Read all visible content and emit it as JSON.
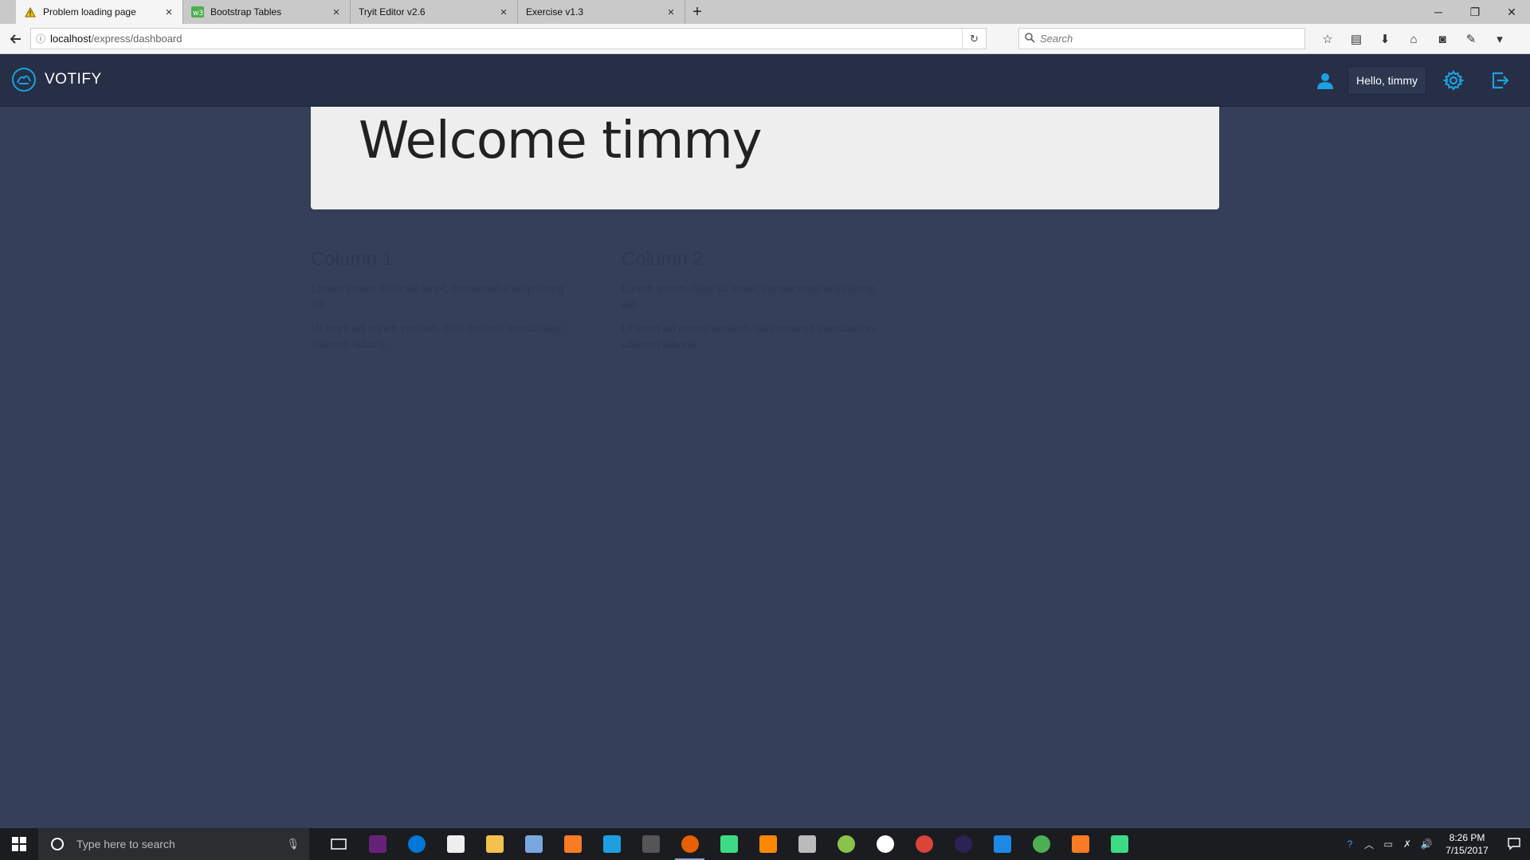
{
  "browser": {
    "tabs": [
      {
        "label": "Problem loading page",
        "icon": "warning-icon"
      },
      {
        "label": "Bootstrap Tables",
        "icon": "w3-icon"
      },
      {
        "label": "Tryit Editor v2.6",
        "icon": "none"
      },
      {
        "label": "Exercise v1.3",
        "icon": "none"
      }
    ],
    "url_host": "localhost",
    "url_path": "/express/dashboard",
    "search_placeholder": "Search"
  },
  "app": {
    "brand": "VOTIFY",
    "greeting": "Hello,  timmy",
    "accent": "#1aa1e0"
  },
  "jumbotron": {
    "title": "Welcome timmy"
  },
  "columns": [
    {
      "heading": "Column 1",
      "p1": "Lorem ipsum dolor sit amet, consectetur adipisicing elit.",
      "p2": "Ut enim ad minim veniam, quis nostrud exercitation ullamco laboris."
    },
    {
      "heading": "Column 2",
      "p1": "Lorem ipsum dolor sit amet, consectetur adipisicing elit.",
      "p2": "Ut enim ad minim veniam, quis nostrud exercitation ullamco laboris."
    }
  ],
  "taskbar": {
    "search_placeholder": "Type here to search",
    "time": "8:26 PM",
    "date": "7/15/2017"
  }
}
